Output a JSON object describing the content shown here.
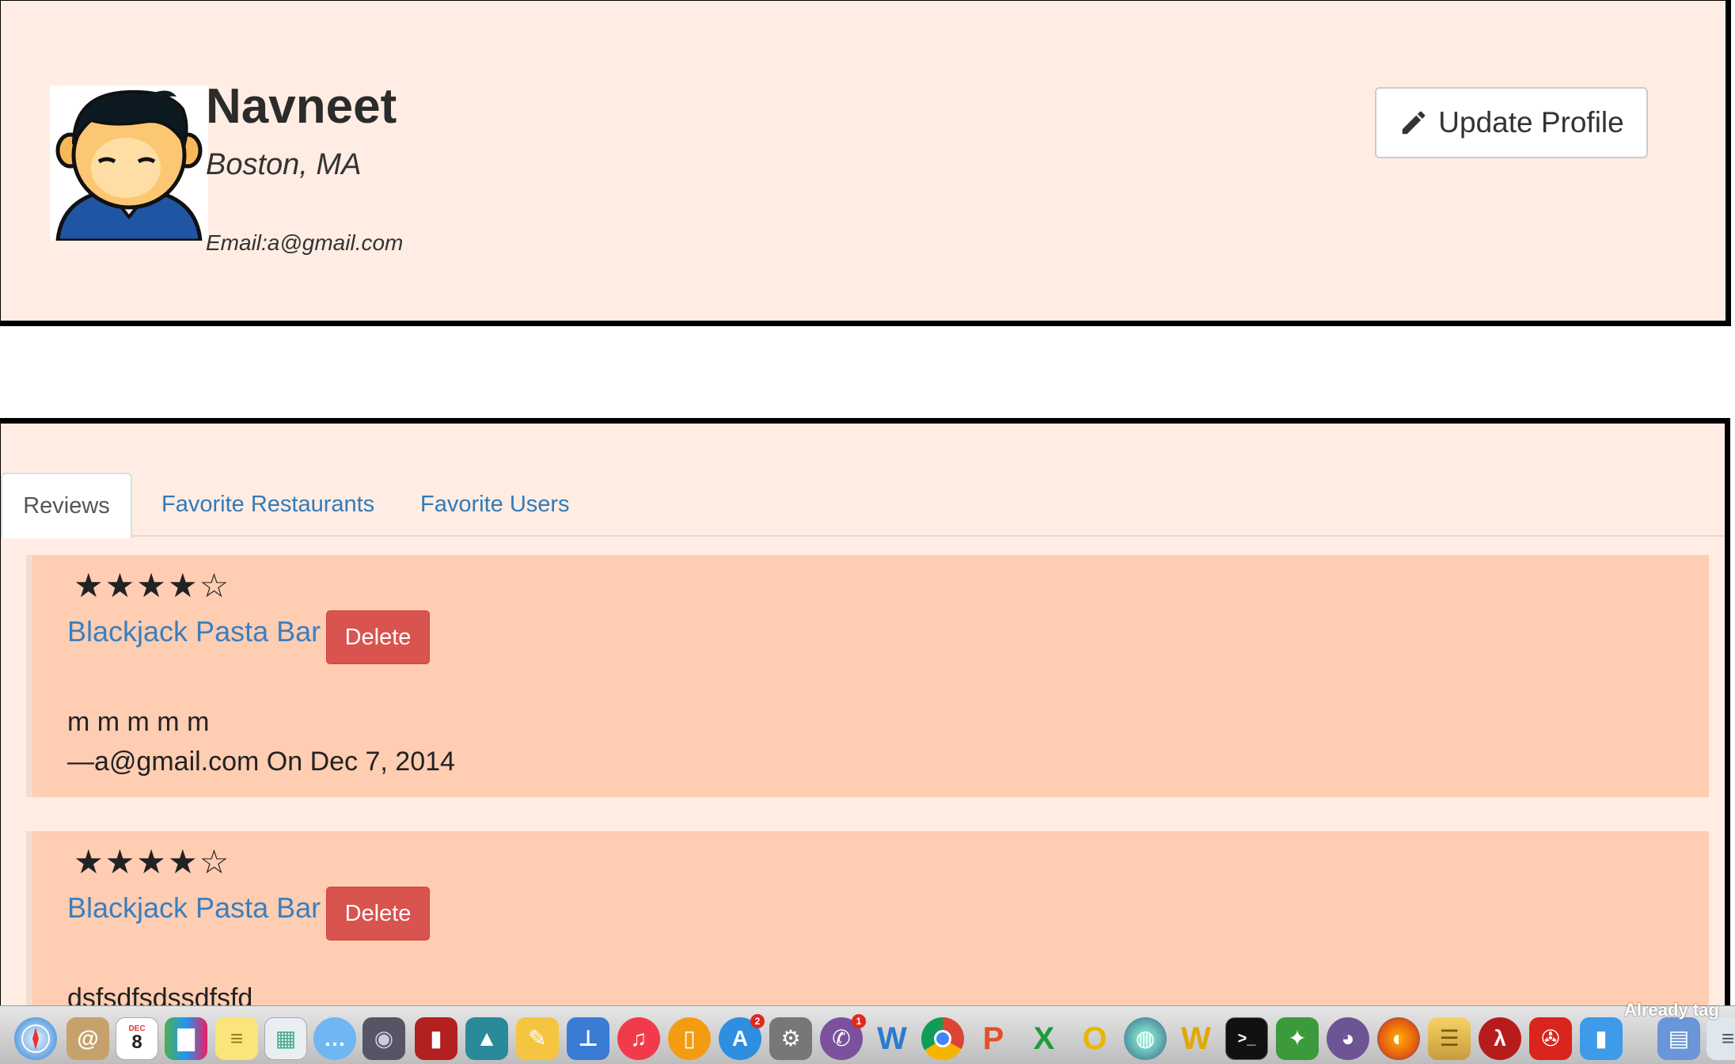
{
  "profile": {
    "name": "Navneet",
    "location": "Boston, MA",
    "email": "Email:a@gmail.com",
    "update_button_label": "Update Profile"
  },
  "tabs": [
    {
      "label": "Reviews",
      "active": true
    },
    {
      "label": "Favorite Restaurants",
      "active": false
    },
    {
      "label": "Favorite Users",
      "active": false
    }
  ],
  "reviews": [
    {
      "stars": "★★★★☆",
      "rating": 4,
      "restaurant": "Blackjack Pasta Bar",
      "delete_label": "Delete",
      "text": "m m m m m",
      "footer": "—a@gmail.com On Dec 7, 2014"
    },
    {
      "stars": "★★★★☆",
      "rating": 4,
      "restaurant": "Blackjack Pasta Bar",
      "delete_label": "Delete",
      "text": "dsfsdfsdssdfsfd",
      "footer": ""
    }
  ],
  "dock": {
    "overlay_text": "Already tag",
    "calendar_day": "8",
    "badges": {
      "app_store": "2",
      "viber": "1"
    }
  },
  "colors": {
    "panel_bg": "#ffede3",
    "review_bg": "#ffcdb2",
    "link": "#337ab7",
    "danger": "#d9534f"
  }
}
